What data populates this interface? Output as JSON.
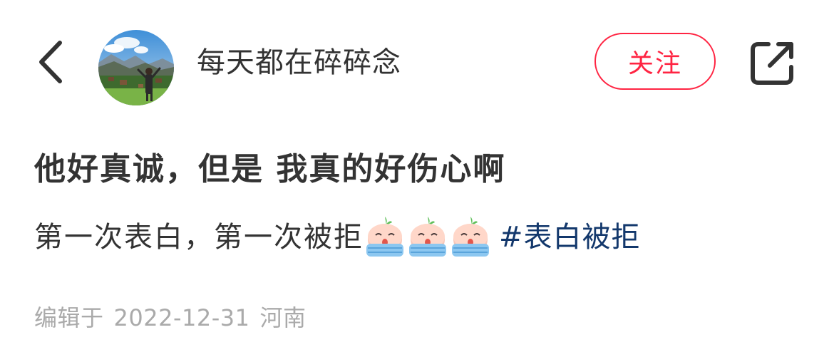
{
  "header": {
    "back_icon": "chevron-left-icon",
    "username": "每天都在碎碎念",
    "follow_label": "关注",
    "share_icon": "share-external-icon",
    "accent_color": "#ff2442"
  },
  "post": {
    "title": "他好真诚，但是 我真的好伤心啊",
    "body_text": "第一次表白，第一次被拒",
    "emojis": [
      "crying-face-emoji",
      "crying-face-emoji",
      "crying-face-emoji"
    ],
    "hashtag": "#表白被拒",
    "hashtag_color": "#13386c"
  },
  "meta": {
    "edited_label": "编辑于",
    "date": "2022-12-31",
    "location": "河南"
  }
}
